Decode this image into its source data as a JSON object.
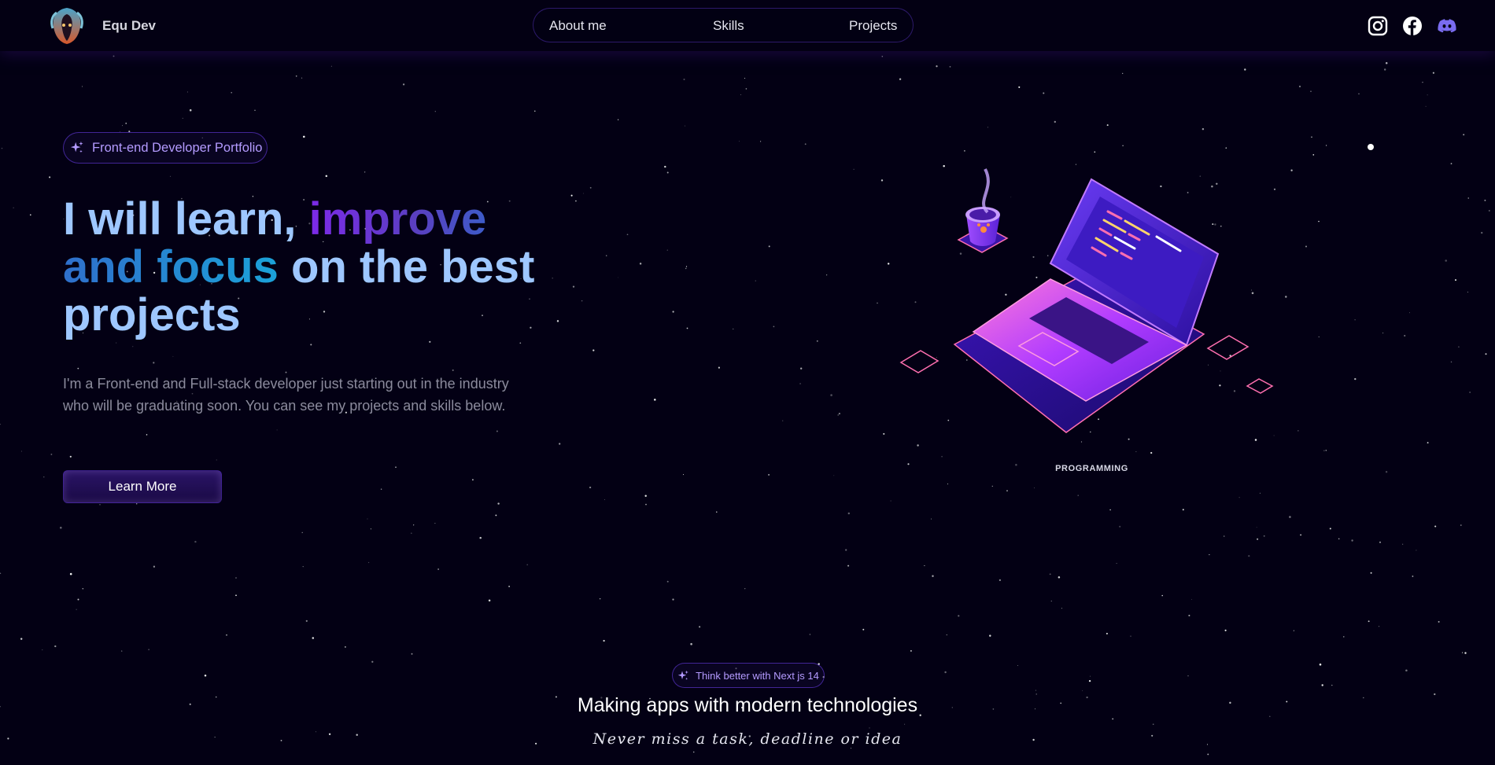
{
  "navbar": {
    "brand_name": "Equ Dev",
    "links": [
      {
        "label": "About me"
      },
      {
        "label": "Skills"
      },
      {
        "label": "Projects"
      }
    ],
    "socials": [
      "instagram-icon",
      "facebook-icon",
      "discord-icon"
    ]
  },
  "hero": {
    "badge_text": "Front-end Developer Portfolio",
    "headline": {
      "part1": "I will learn, ",
      "part2": "improve",
      "part3": "and focus",
      "part4": " on the best projects"
    },
    "description": "I'm a Front-end and Full-stack developer just starting out in the industry who will be graduating soon. You can see my projects and skills below.",
    "button_label": "Learn More",
    "illustration_label": "PROGRAMMING"
  },
  "section": {
    "badge_text": "Think better with Next js 14",
    "title": "Making apps with modern technologies",
    "subtitle": "Never miss a task, deadline or idea"
  },
  "colors": {
    "background": "#030014",
    "accent": "#7042f8",
    "headline_blue": "#9ec7ff",
    "badge_text": "#b49bff"
  }
}
